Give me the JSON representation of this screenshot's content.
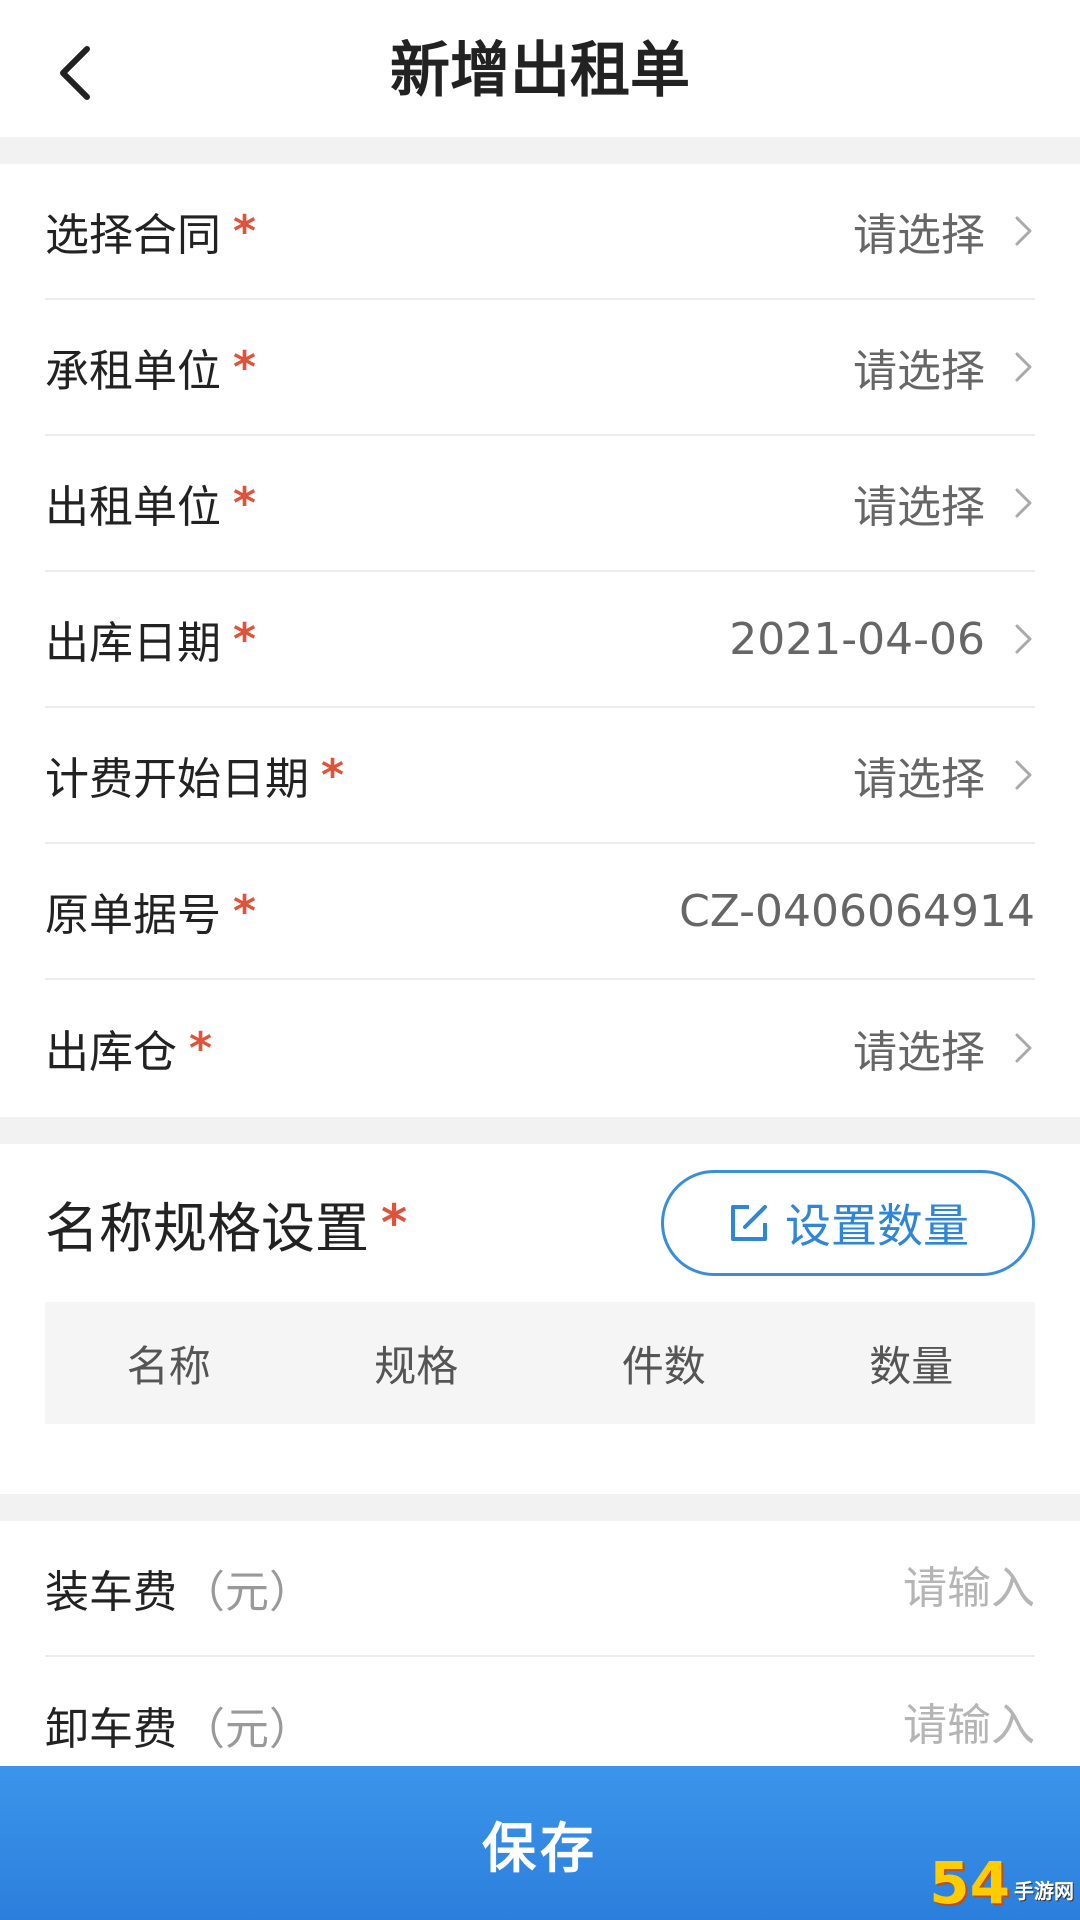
{
  "header": {
    "title": "新增出租单"
  },
  "form": {
    "rows": [
      {
        "label": "选择合同",
        "required": "*",
        "value": "请选择"
      },
      {
        "label": "承租单位",
        "required": "*",
        "value": "请选择"
      },
      {
        "label": "出租单位",
        "required": "*",
        "value": "请选择"
      },
      {
        "label": "出库日期",
        "required": "*",
        "value": "2021-04-06"
      },
      {
        "label": "计费开始日期",
        "required": "*",
        "value": "请选择"
      },
      {
        "label": "原单据号",
        "required": "*",
        "value": "CZ-0406064914"
      },
      {
        "label": "出库仓",
        "required": "*",
        "value": "请选择"
      }
    ]
  },
  "spec": {
    "title": "名称规格设置",
    "required": "*",
    "button_label": "设置数量",
    "columns": [
      "名称",
      "规格",
      "件数",
      "数量"
    ]
  },
  "fees": [
    {
      "label": "装车费",
      "unit": "（元）",
      "placeholder": "请输入"
    },
    {
      "label": "卸车费",
      "unit": "（元）",
      "placeholder": "请输入"
    }
  ],
  "footer": {
    "save_label": "保存"
  },
  "watermark": {
    "logo": "54",
    "site": "手游网"
  },
  "colors": {
    "accent": "#2f86d6",
    "required": "#e0533a",
    "save_bar": "#3388e4"
  }
}
